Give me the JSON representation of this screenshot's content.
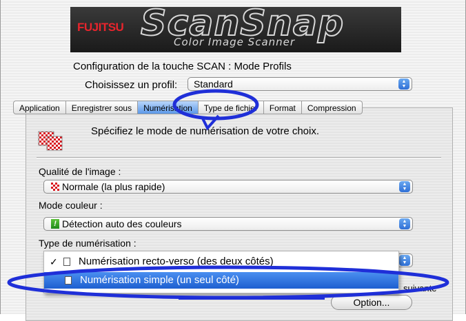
{
  "banner": {
    "brand": "FUJITSU",
    "product": "ScanSnap",
    "subtitle": "Color Image Scanner"
  },
  "dialog_title": "Configuration de la touche SCAN : Mode Profils",
  "profile": {
    "label": "Choisissez un profil:",
    "value": "Standard"
  },
  "tabs": [
    {
      "label": "Application",
      "active": false
    },
    {
      "label": "Enregistrer sous",
      "active": false
    },
    {
      "label": "Numérisation",
      "active": true
    },
    {
      "label": "Type de fichier",
      "active": false
    },
    {
      "label": "Format",
      "active": false
    },
    {
      "label": "Compression",
      "active": false
    }
  ],
  "panel": {
    "description": "Spécifiez le mode de numérisation de votre choix.",
    "quality_label": "Qualité de l'image :",
    "quality_value": "Normale (la plus rapide)",
    "color_label": "Mode couleur :",
    "color_value": "Détection auto des couleurs",
    "scan_type_label": "Type de numérisation :",
    "scan_type_options": [
      {
        "label": "Numérisation recto-verso (des deux côtés)",
        "checked": true,
        "highlighted": false
      },
      {
        "label": "Numérisation simple (un seul côté)",
        "checked": false,
        "highlighted": true
      }
    ],
    "partially_hidden_text": "suivante",
    "option_button": "Option..."
  },
  "colors": {
    "annotation": "#1f2fd8",
    "selection": "#2f6fd6",
    "brand_red": "#e8242c"
  },
  "icons": {
    "scan_mode": "checkerboard-scan-icon",
    "quality": "checkerboard-quality-icon",
    "color_mode": "exclamation-color-icon",
    "document": "document-icon",
    "checkmark": "checkmark-icon",
    "popup_arrows": "up-down-arrows-icon"
  }
}
